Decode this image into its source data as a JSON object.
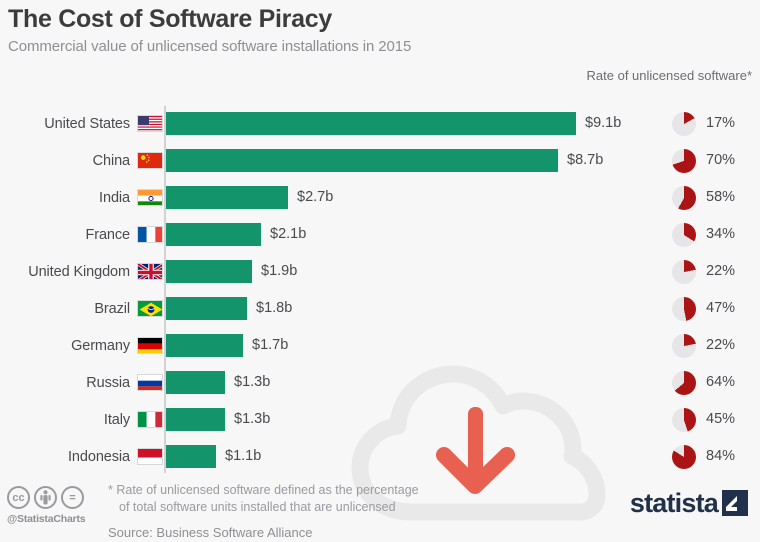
{
  "header": {
    "title": "The Cost of Software Piracy",
    "subtitle": "Commercial value of unlicensed software installations in 2015",
    "rate_header": "Rate of unlicensed software*"
  },
  "footer": {
    "note_line_1": "* Rate of unlicensed software defined as the percentage",
    "note_line_2": "of total software units installed that are unlicensed",
    "source": "Source: Business Software Alliance",
    "cc_handle": "@StatistaCharts",
    "cc_icons": [
      "cc-icon",
      "cc-by-icon",
      "cc-nd-icon"
    ],
    "logo_text": "statista"
  },
  "colors": {
    "bar": "#13946b",
    "pie_filled": "#ab1414",
    "pie_empty": "#e6e6e8",
    "background": "#f7f7f7",
    "text": "#4a4a4f",
    "muted": "#9a9aa0",
    "arrow": "#e8604f",
    "cloud": "#e9e9e9",
    "logo": "#22314b"
  },
  "chart_data": {
    "type": "bar",
    "title": "The Cost of Software Piracy",
    "subtitle": "Commercial value of unlicensed software installations in 2015",
    "xlabel": "",
    "ylabel": "",
    "orientation": "horizontal",
    "grid": false,
    "legend": false,
    "xlim": [
      0,
      9.1
    ],
    "value_unit": "billion USD",
    "categories": [
      "United States",
      "China",
      "India",
      "France",
      "United Kingdom",
      "Brazil",
      "Germany",
      "Russia",
      "Italy",
      "Indonesia"
    ],
    "values": [
      9.1,
      8.7,
      2.7,
      2.1,
      1.9,
      1.8,
      1.7,
      1.3,
      1.3,
      1.1
    ],
    "value_labels": [
      "$9.1b",
      "$8.7b",
      "$2.7b",
      "$2.1b",
      "$1.9b",
      "$1.8b",
      "$1.7b",
      "$1.3b",
      "$1.3b",
      "$1.1b"
    ],
    "secondary_series": {
      "name": "Rate of unlicensed software*",
      "type": "pie",
      "unit": "percent",
      "values": [
        17,
        70,
        58,
        34,
        22,
        47,
        22,
        64,
        45,
        84
      ],
      "labels": [
        "17%",
        "70%",
        "58%",
        "34%",
        "22%",
        "47%",
        "22%",
        "64%",
        "45%",
        "84%"
      ]
    },
    "annotations": [
      "* Rate of unlicensed software defined as the percentage of total software units installed that are unlicensed"
    ],
    "source": "Source: Business Software Alliance"
  },
  "rows": [
    {
      "country": "United States",
      "flag": "flag-us",
      "value": 9.1,
      "value_label": "$9.1b",
      "rate": 17,
      "rate_label": "17%"
    },
    {
      "country": "China",
      "flag": "flag-cn",
      "value": 8.7,
      "value_label": "$8.7b",
      "rate": 70,
      "rate_label": "70%"
    },
    {
      "country": "India",
      "flag": "flag-in",
      "value": 2.7,
      "value_label": "$2.7b",
      "rate": 58,
      "rate_label": "58%"
    },
    {
      "country": "France",
      "flag": "flag-fr",
      "value": 2.1,
      "value_label": "$2.1b",
      "rate": 34,
      "rate_label": "34%"
    },
    {
      "country": "United Kingdom",
      "flag": "flag-gb",
      "value": 1.9,
      "value_label": "$1.9b",
      "rate": 22,
      "rate_label": "22%"
    },
    {
      "country": "Brazil",
      "flag": "flag-br",
      "value": 1.8,
      "value_label": "$1.8b",
      "rate": 47,
      "rate_label": "47%"
    },
    {
      "country": "Germany",
      "flag": "flag-de",
      "value": 1.7,
      "value_label": "$1.7b",
      "rate": 22,
      "rate_label": "22%"
    },
    {
      "country": "Russia",
      "flag": "flag-ru",
      "value": 1.3,
      "value_label": "$1.3b",
      "rate": 64,
      "rate_label": "64%"
    },
    {
      "country": "Italy",
      "flag": "flag-it",
      "value": 1.3,
      "value_label": "$1.3b",
      "rate": 45,
      "rate_label": "45%"
    },
    {
      "country": "Indonesia",
      "flag": "flag-id",
      "value": 1.1,
      "value_label": "$1.1b",
      "rate": 84,
      "rate_label": "84%"
    }
  ]
}
